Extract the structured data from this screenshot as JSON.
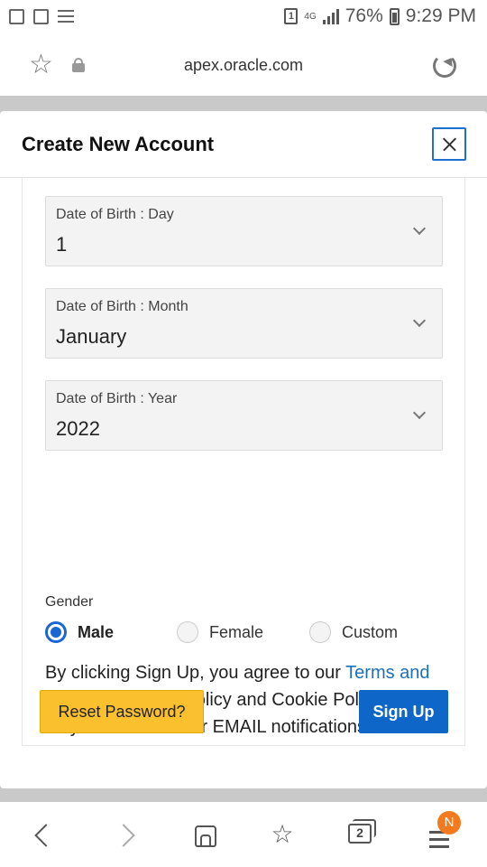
{
  "status_bar": {
    "sim_label": "1",
    "network": "4G",
    "battery": "76%",
    "time": "9:29 PM"
  },
  "address_bar": {
    "url": "apex.oracle.com"
  },
  "dialog": {
    "title": "Create New Account",
    "dob_day": {
      "label": "Date of Birth : Day",
      "value": "1"
    },
    "dob_month": {
      "label": "Date of Birth : Month",
      "value": "January"
    },
    "dob_year": {
      "label": "Date of Birth : Year",
      "value": "2022"
    },
    "gender": {
      "label": "Gender",
      "options": [
        "Male",
        "Female",
        "Custom"
      ],
      "selected": "Male"
    },
    "terms": {
      "prefix": "By clicking Sign Up, you agree to our ",
      "link": "Terms and Conditions.",
      "suffix": " Data Policy and Cookie Policy. You may receive SMS or EMAIL notifications from us."
    },
    "reset_button": "Reset Password?",
    "signup_button": "Sign Up"
  },
  "bottom_nav": {
    "tabs_count": "2",
    "menu_badge": "N"
  }
}
